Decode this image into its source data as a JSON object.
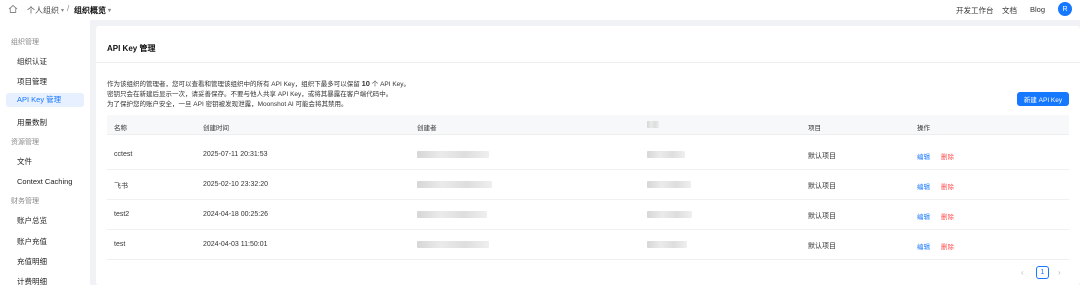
{
  "breadcrumb": {
    "org": "个人组织",
    "page": "组织概览"
  },
  "topnav": {
    "workbench": "开发工作台",
    "docs": "文档",
    "blog": "Blog",
    "avatar": "R"
  },
  "sidebar": {
    "sections": [
      {
        "title": "组织管理",
        "items": [
          "组织认证",
          "项目管理",
          "API Key 管理",
          "用量数制"
        ]
      },
      {
        "title": "资源管理",
        "items": [
          "文件",
          "Context Caching"
        ]
      },
      {
        "title": "财务管理",
        "items": [
          "账户总览",
          "账户充值",
          "充值明细",
          "计费明细"
        ]
      }
    ],
    "active": "API Key 管理"
  },
  "main": {
    "title": "API Key 管理",
    "desc": {
      "line1_pre": "作为该组织的管理者，您可以查看和管理该组织中的所有 API Key，组织下最多可以保留 ",
      "line1_num": "10",
      "line1_post": " 个 API Key。",
      "line2": "密钥只会在新建后显示一次，请妥善保存。不要与他人共享 API Key，或将其暴露在客户端代码中。",
      "line3": "为了保护您的账户安全，一旦 API 密钥被发现泄露，Moonshot AI 可能会将其禁用。"
    },
    "new_button": "新建 API Key",
    "columns": [
      "名称",
      "创建时间",
      "创建者",
      "",
      "项目",
      "操作"
    ],
    "rows": [
      {
        "name": "cctest",
        "created": "2025-07-11 20:31:53",
        "project": "默认项目",
        "edit": "编辑",
        "delete": "删除"
      },
      {
        "name": "飞书",
        "created": "2025-02-10 23:32:20",
        "project": "默认项目",
        "edit": "编辑",
        "delete": "删除"
      },
      {
        "name": "test2",
        "created": "2024-04-18 00:25:26",
        "project": "默认项目",
        "edit": "编辑",
        "delete": "删除"
      },
      {
        "name": "test",
        "created": "2024-04-03 11:50:01",
        "project": "默认项目",
        "edit": "编辑",
        "delete": "删除"
      }
    ],
    "pagination": {
      "current": "1",
      "prev": "‹",
      "next": "›"
    }
  },
  "icons": {
    "home": "home-icon",
    "chevron": "chevron-down-icon"
  },
  "colors": {
    "accent": "#1677ff",
    "danger": "#ff4d4f"
  }
}
